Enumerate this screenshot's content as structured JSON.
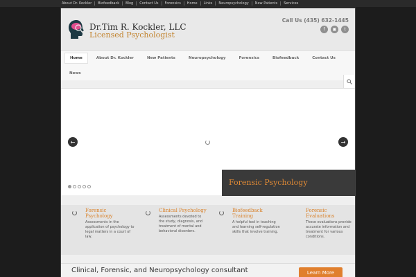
{
  "topbar": {
    "links": [
      "About Dr. Kockler",
      "Biofeedback",
      "Blog",
      "Contact Us",
      "Forensics",
      "Home",
      "Links",
      "Neuropsychology",
      "New Patients",
      "Services"
    ]
  },
  "header": {
    "logo_title": "Dr.Tim R. Kockler, LLC",
    "logo_subtitle": "Licensed Psychologist",
    "phone": "Call Us (435) 632-1445",
    "social_icons": [
      "facebook-icon",
      "instagram-icon",
      "twitter-icon"
    ]
  },
  "nav": {
    "items": [
      "Home",
      "About Dr. Kockler",
      "New Patients",
      "Neuropsychology",
      "Forensics",
      "Biofeedback",
      "Contact Us"
    ],
    "second_row": [
      "News"
    ],
    "active": "Home"
  },
  "slider": {
    "caption": "Forensic Psychology",
    "dot_count": 5,
    "active_dot": 0
  },
  "features": [
    {
      "title": "Forensic Psychology",
      "desc": "Assessments in the application of psychology to legal matters in a court of law."
    },
    {
      "title": "Clinical Psychology",
      "desc": "Assessments devoted to the study, diagnosis, and treatment of mental and behavioral disorders."
    },
    {
      "title": "Biofeedback Training",
      "desc": "A helpful tool in teaching and learning self-regulation skills that involve training."
    },
    {
      "title": "Forensic Evaluations",
      "desc": "These evaluations provide accurate information and treatment for various conditions."
    }
  ],
  "bottom": {
    "tagline": "Clinical, Forensic, and Neuropsychology consultant",
    "button": "Learn More"
  },
  "colors": {
    "accent": "#e07f2e",
    "caption_bg": "#3a3a3a",
    "topbar_bg": "#2a2a2a"
  }
}
